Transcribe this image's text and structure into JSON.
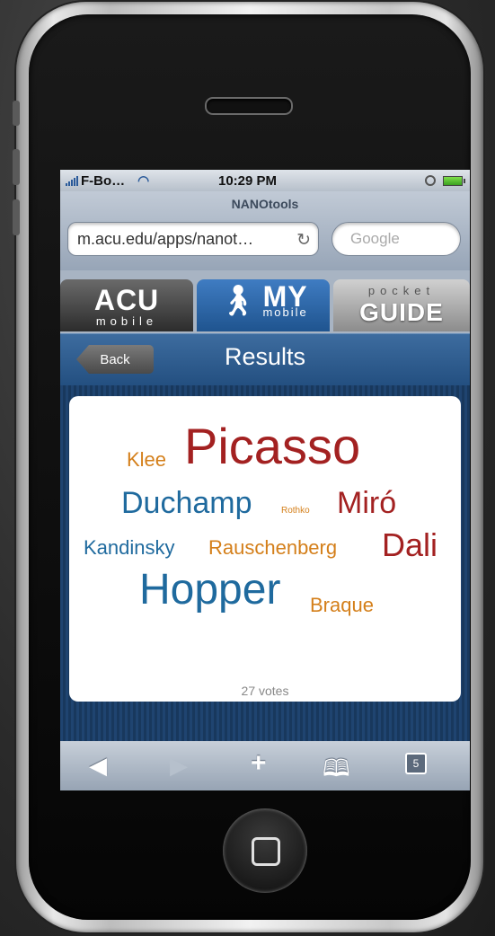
{
  "status_bar": {
    "carrier": "F-Bo…",
    "time": "10:29 PM"
  },
  "browser": {
    "page_title": "NANOtools",
    "url": "m.acu.edu/apps/nanot…",
    "search_placeholder": "Google"
  },
  "app_tabs": {
    "acu": {
      "big": "ACU",
      "small": "mobile"
    },
    "my": {
      "big": "MY",
      "small": "mobile"
    },
    "guide": {
      "small": "pocket",
      "big": "GUIDE"
    }
  },
  "nav": {
    "back_label": "Back",
    "title": "Results"
  },
  "word_cloud": {
    "words": [
      {
        "text": "Klee",
        "color": "#d47f1a"
      },
      {
        "text": "Picasso",
        "color": "#a32121"
      },
      {
        "text": "Duchamp",
        "color": "#1f6a9e"
      },
      {
        "text": "Rothko",
        "color": "#d47f1a"
      },
      {
        "text": "Miró",
        "color": "#a32121"
      },
      {
        "text": "Kandinsky",
        "color": "#1f6a9e"
      },
      {
        "text": "Rauschenberg",
        "color": "#d47f1a"
      },
      {
        "text": "Dali",
        "color": "#a32121"
      },
      {
        "text": "Hopper",
        "color": "#1f6a9e"
      },
      {
        "text": "Braque",
        "color": "#d47f1a"
      }
    ],
    "votes_label": "27 votes"
  },
  "toolbar": {
    "pages_count": "5"
  },
  "icons": [
    "wifi-icon",
    "reload-icon",
    "walker-icon",
    "back-arrow-icon",
    "forward-arrow-icon",
    "add-icon",
    "bookmarks-icon",
    "pages-icon",
    "home-button-icon"
  ]
}
